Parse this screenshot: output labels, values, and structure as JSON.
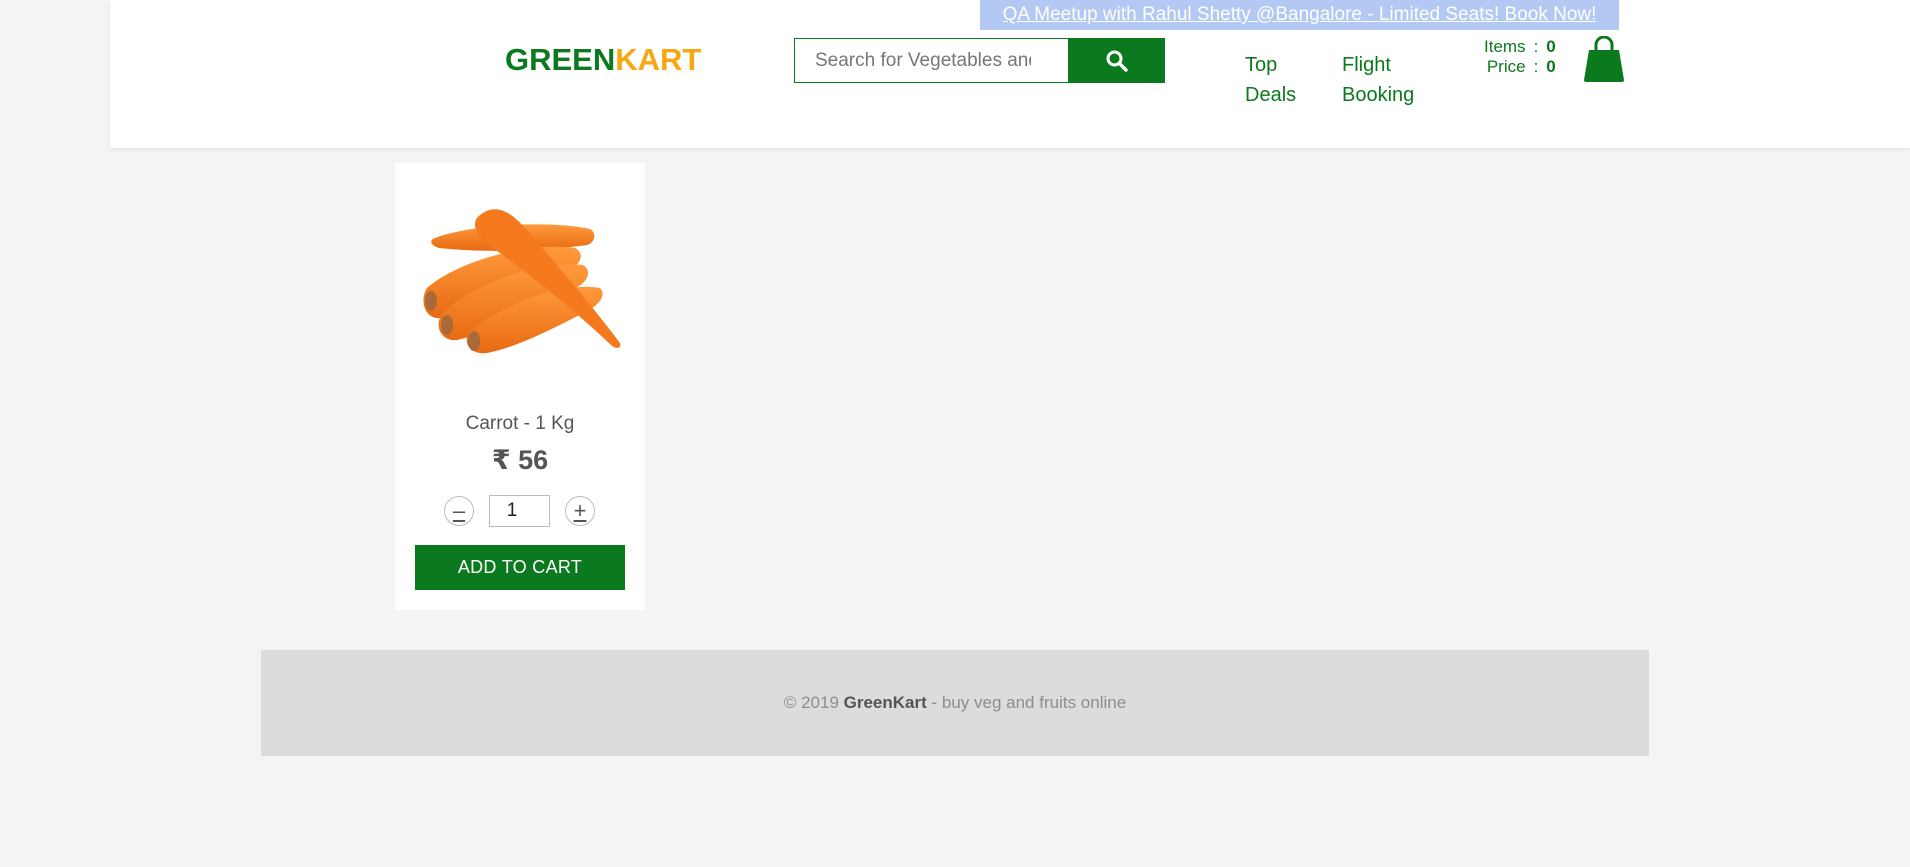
{
  "header": {
    "promo_text": "QA Meetup with Rahul Shetty @Bangalore - Limited Seats! Book Now!",
    "logo_part1": "GREEN",
    "logo_part2": "KART",
    "search_placeholder": "Search for Vegetables and Fruits",
    "nav": {
      "top_deals_line1": "Top",
      "top_deals_line2": "Deals",
      "flight_booking_line1": "Flight",
      "flight_booking_line2": "Booking"
    },
    "cart": {
      "items_label": "Items",
      "items_value": "0",
      "price_label": "Price",
      "price_value": "0",
      "separator": ":"
    }
  },
  "product": {
    "name": "Carrot - 1 Kg",
    "price": "₹ 56",
    "quantity": "1",
    "minus_label": "–",
    "plus_label": "+",
    "add_to_cart_label": "ADD TO CART"
  },
  "footer": {
    "prefix": "© 2019 ",
    "brand": "GreenKart",
    "suffix": " - buy veg and fruits online"
  },
  "colors": {
    "brand_green": "#0b7a1e",
    "brand_orange": "#f7a711",
    "promo_bg": "#b3c8f2"
  },
  "icons": {
    "search": "search-icon",
    "cart": "shopping-bag-icon"
  }
}
